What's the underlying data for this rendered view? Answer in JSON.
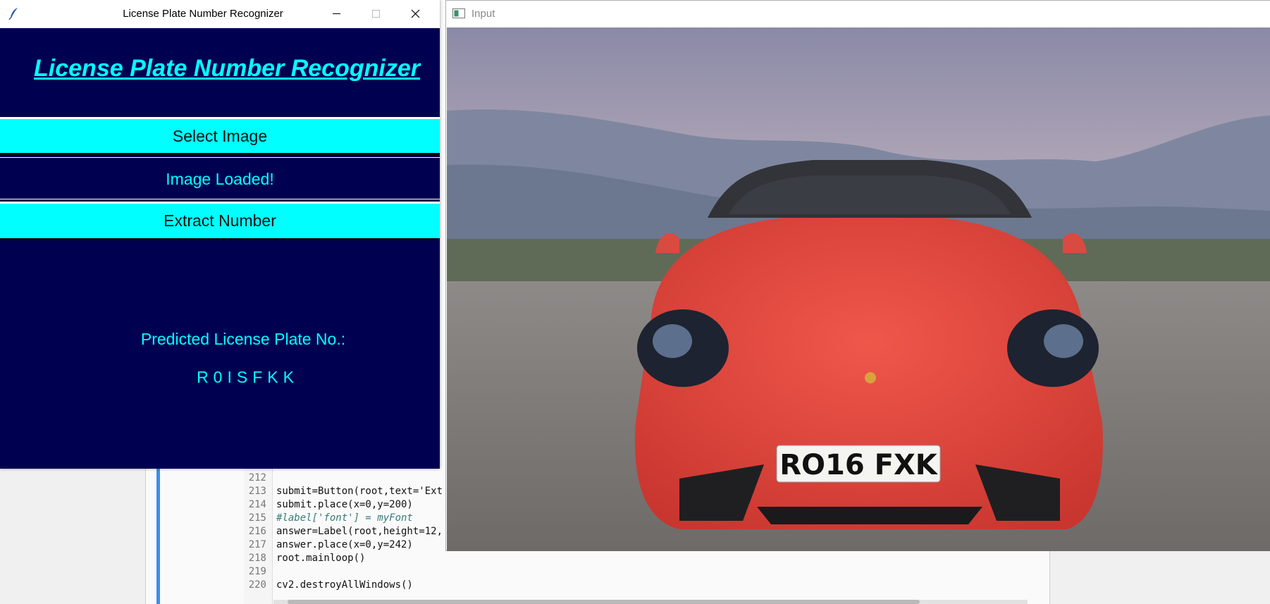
{
  "tk_window": {
    "title": "License Plate Number Recognizer",
    "heading": "License Plate Number Recognizer",
    "select_button_label": "Select Image",
    "status_text": "Image Loaded!",
    "extract_button_label": "Extract Number",
    "result_caption": "Predicted License Plate No.:",
    "result_value": "R0ISFKK"
  },
  "input_window": {
    "title": "Input",
    "plate_text": "RO16 FXK"
  },
  "editor": {
    "lines": [
      {
        "n": "212",
        "code": ""
      },
      {
        "n": "213",
        "code": "submit=Button(root,text='Ext"
      },
      {
        "n": "214",
        "code": "submit.place(x=0,y=200)"
      },
      {
        "n": "215",
        "code": "#label['font'] = myFont"
      },
      {
        "n": "216",
        "code": "answer=Label(root,height=12,"
      },
      {
        "n": "217",
        "code": "answer.place(x=0,y=242)"
      },
      {
        "n": "218",
        "code": "root.mainloop()"
      },
      {
        "n": "219",
        "code": ""
      },
      {
        "n": "220",
        "code": "cv2.destroyAllWindows()"
      }
    ]
  },
  "colors": {
    "tk_background": "#000050",
    "accent_cyan": "#00ffff",
    "car_red": "#e0463f"
  },
  "icons": [
    "feather-icon",
    "minimize-icon",
    "maximize-icon",
    "close-icon",
    "opencv-window-icon"
  ]
}
